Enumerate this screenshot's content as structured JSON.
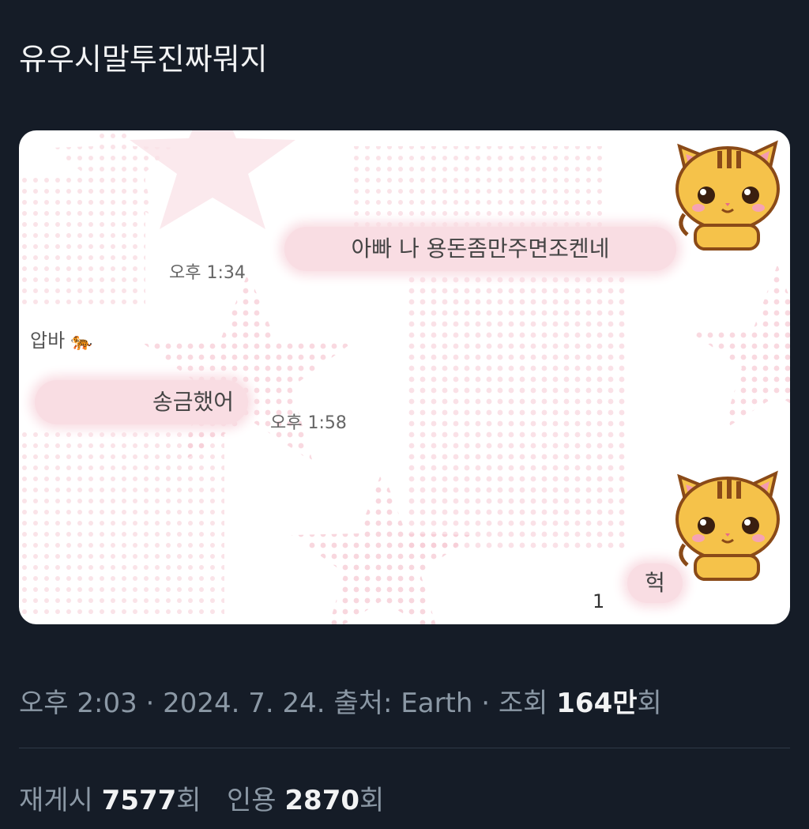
{
  "tweet": {
    "text": "유우시말투진짜뭐지"
  },
  "chat": {
    "msg1": {
      "text": "아빠 나 용돈좀만주면조켄네",
      "time": "오후 1:34"
    },
    "sender": {
      "name": "압바",
      "emoji": "🐅"
    },
    "msg2": {
      "text": "송금했어",
      "time": "오후 1:58"
    },
    "msg3": {
      "text": "헉",
      "unread": "1"
    }
  },
  "meta": {
    "time": "오후 2:03",
    "date": "2024. 7. 24.",
    "source_label": "출처:",
    "source": "Earth",
    "views_label": "조회",
    "views_value": "164만",
    "views_unit": "회"
  },
  "stats": {
    "reposts_label": "재게시",
    "reposts_value": "7577",
    "reposts_unit": "회",
    "quotes_label": "인용",
    "quotes_value": "2870",
    "quotes_unit": "회"
  },
  "colors": {
    "background": "#151c27",
    "bubble": "#f9dde3",
    "star": "#fbe3e8"
  }
}
